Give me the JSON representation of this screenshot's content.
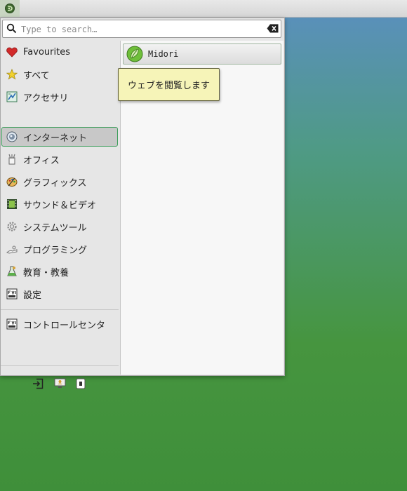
{
  "search": {
    "placeholder": "Type to search…",
    "value": ""
  },
  "sidebar": {
    "items": [
      {
        "label": "Favourites",
        "icon": "heart-icon"
      },
      {
        "label": "すべて",
        "icon": "star-icon"
      },
      {
        "label": "アクセサリ",
        "icon": "accessories-icon"
      },
      {
        "label": "インターネット",
        "icon": "internet-globe-icon",
        "active": true
      },
      {
        "label": "オフィス",
        "icon": "office-icon"
      },
      {
        "label": "グラフィックス",
        "icon": "graphics-palette-icon"
      },
      {
        "label": "サウンド＆ビデオ",
        "icon": "film-strip-icon"
      },
      {
        "label": "システムツール",
        "icon": "gear-icon"
      },
      {
        "label": "プログラミング",
        "icon": "programming-icon"
      },
      {
        "label": "教育・教養",
        "icon": "education-flask-icon"
      },
      {
        "label": "設定",
        "icon": "settings-panel-icon"
      },
      {
        "label": "コントロールセンタ",
        "icon": "control-center-icon"
      }
    ]
  },
  "apps": [
    {
      "label": "Midori",
      "icon": "midori-leaf-icon"
    }
  ],
  "tooltip": {
    "text": "ウェブを閲覧します"
  },
  "bottom_actions": [
    "logout-icon",
    "switch-user-icon",
    "lock-screen-icon"
  ],
  "colors": {
    "active_border": "#3e9e5c",
    "tooltip_bg": "#f6f4b8"
  }
}
